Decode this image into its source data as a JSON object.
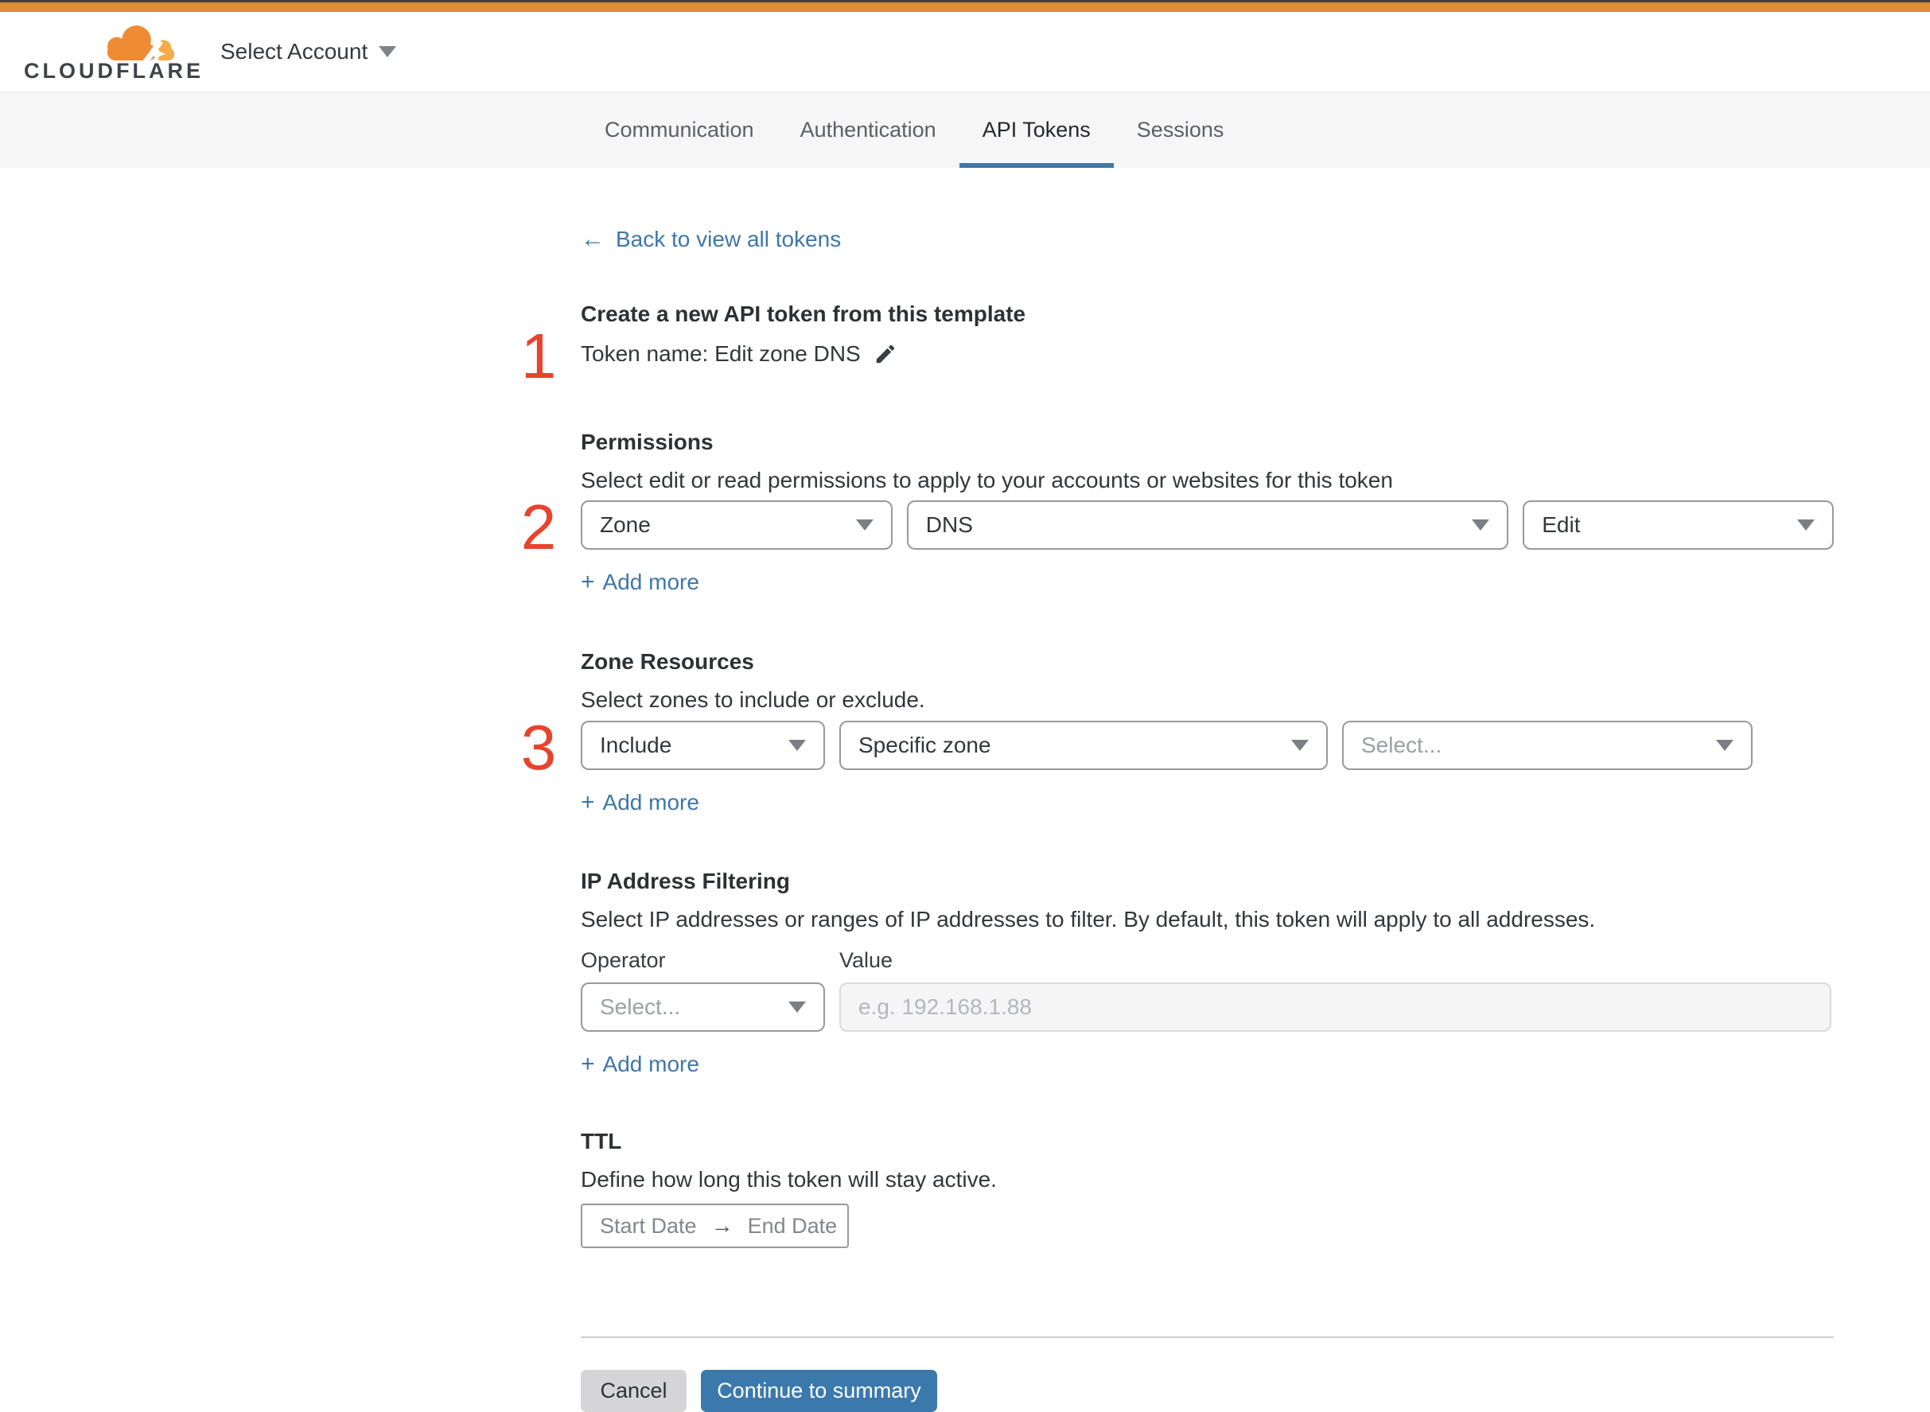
{
  "header": {
    "logo_text": "CLOUDFLARE",
    "account_selector": "Select Account"
  },
  "tabs": {
    "items": [
      {
        "label": "Communication",
        "active": false
      },
      {
        "label": "Authentication",
        "active": false
      },
      {
        "label": "API Tokens",
        "active": true
      },
      {
        "label": "Sessions",
        "active": false
      }
    ]
  },
  "back_link": {
    "arrow": "←",
    "label": "Back to view all tokens"
  },
  "sections": {
    "template": {
      "step": "1",
      "title": "Create a new API token from this template",
      "token_name_line": "Token name: Edit zone DNS"
    },
    "permissions": {
      "step": "2",
      "title": "Permissions",
      "description": "Select edit or read permissions to apply to your accounts or websites for this token",
      "dropdowns": [
        {
          "value": "Zone"
        },
        {
          "value": "DNS"
        },
        {
          "value": "Edit"
        }
      ],
      "add_more": "Add more"
    },
    "zone_resources": {
      "step": "3",
      "title": "Zone Resources",
      "description": "Select zones to include or exclude.",
      "dropdowns": [
        {
          "value": "Include"
        },
        {
          "value": "Specific zone"
        },
        {
          "value": "Select..."
        }
      ],
      "add_more": "Add more"
    },
    "ip_filtering": {
      "title": "IP Address Filtering",
      "description": "Select IP addresses or ranges of IP addresses to filter. By default, this token will apply to all addresses.",
      "operator_label": "Operator",
      "value_label": "Value",
      "operator_placeholder": "Select...",
      "value_placeholder": "e.g. 192.168.1.88",
      "add_more": "Add more"
    },
    "ttl": {
      "title": "TTL",
      "description": "Define how long this token will stay active.",
      "start_label": "Start Date",
      "arrow": "→",
      "end_label": "End Date"
    }
  },
  "footer": {
    "cancel": "Cancel",
    "continue": "Continue to summary"
  },
  "misc": {
    "plus": "+"
  },
  "colors": {
    "top_bar_orange": "#de8c35",
    "logo_orange": "#ee8b33",
    "logo_light_orange": "#f5ab4c",
    "step_marker_red": "#e8432d",
    "link_blue": "#3d77a9",
    "tab_underline_blue": "#4076a5",
    "primary_button_blue": "#3b79ad"
  }
}
